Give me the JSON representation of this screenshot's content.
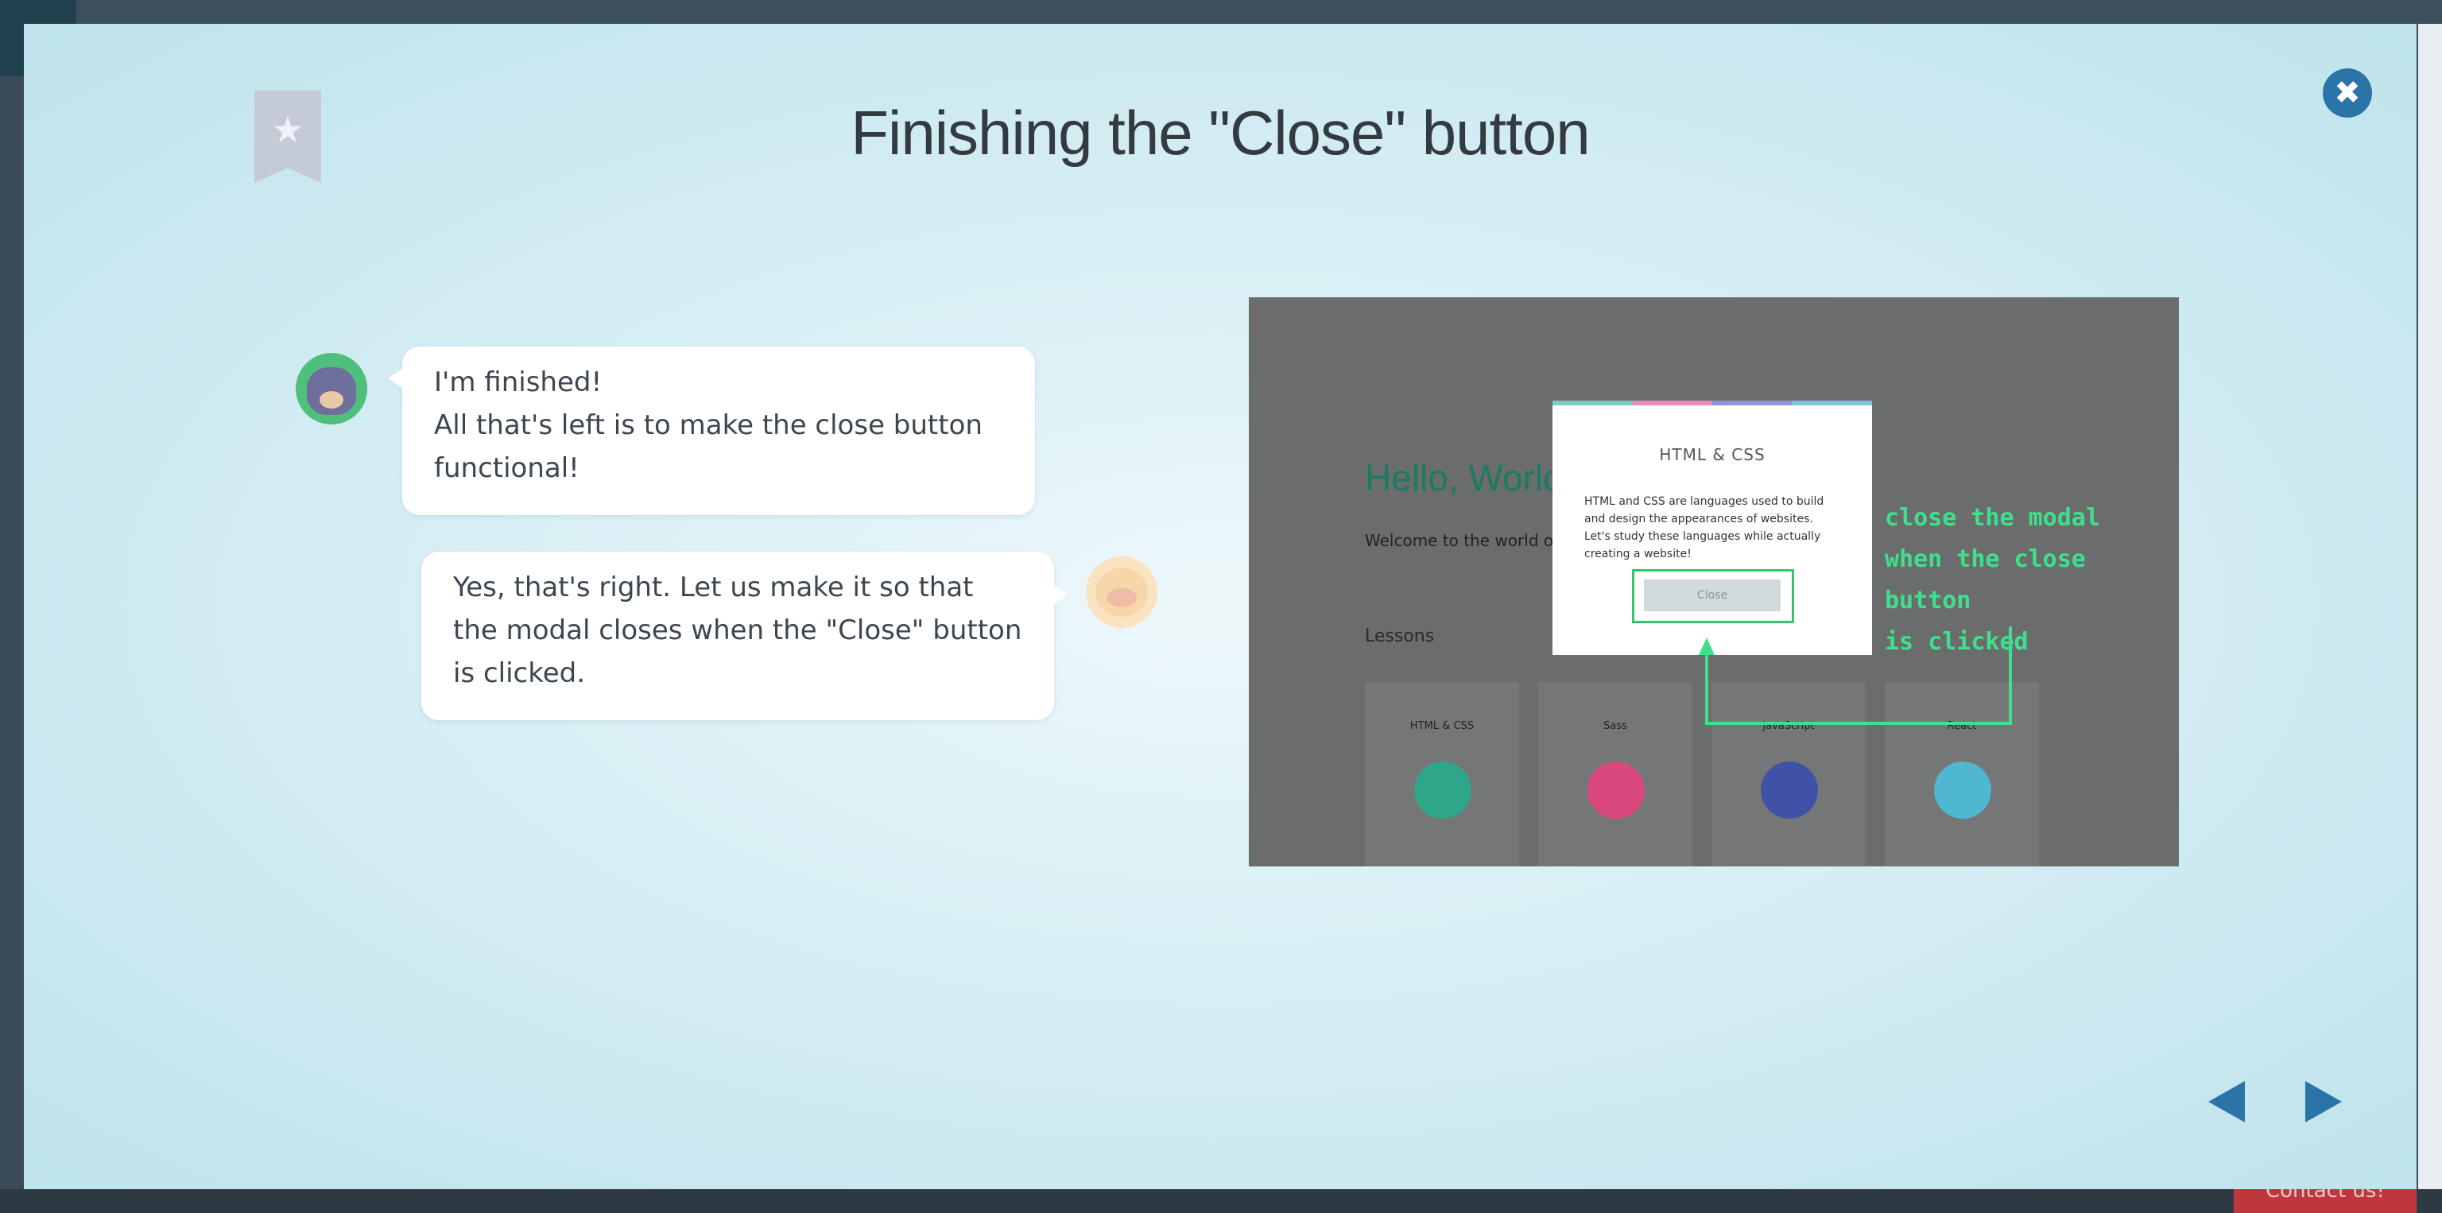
{
  "background": {
    "contact_label": "Contact us!"
  },
  "slide": {
    "title": "Finishing the \"Close\" button",
    "messages": [
      {
        "speaker": "cat",
        "text": "I'm finished!\nAll that's left is to make the close button functional!"
      },
      {
        "speaker": "sheep",
        "text": "Yes, that's right. Let us make it so that the modal closes when the \"Close\" button is clicked."
      }
    ]
  },
  "preview": {
    "hello": "Hello, World",
    "welcome": "Welcome to the world of",
    "lessons_label": "Lessons",
    "cards": [
      {
        "label": "HTML & CSS",
        "color": "#2fa58a"
      },
      {
        "label": "Sass",
        "color": "#d9497f"
      },
      {
        "label": "JavaScript",
        "color": "#3f52a8"
      },
      {
        "label": "React",
        "color": "#4fb7cf"
      }
    ],
    "popup": {
      "title": "HTML & CSS",
      "text": "HTML and CSS are languages used to build and design the appearances of websites. Let's study these languages while actually creating a website!",
      "button": "Close"
    },
    "annotation": "close the modal\nwhen the close button\nis clicked"
  },
  "colors": {
    "accent": "#2a74a8",
    "annotation": "#3de08c"
  },
  "icons": {
    "bookmark": "bookmark-star-icon",
    "close": "close-icon",
    "prev": "prev-arrow-icon",
    "next": "next-arrow-icon"
  }
}
